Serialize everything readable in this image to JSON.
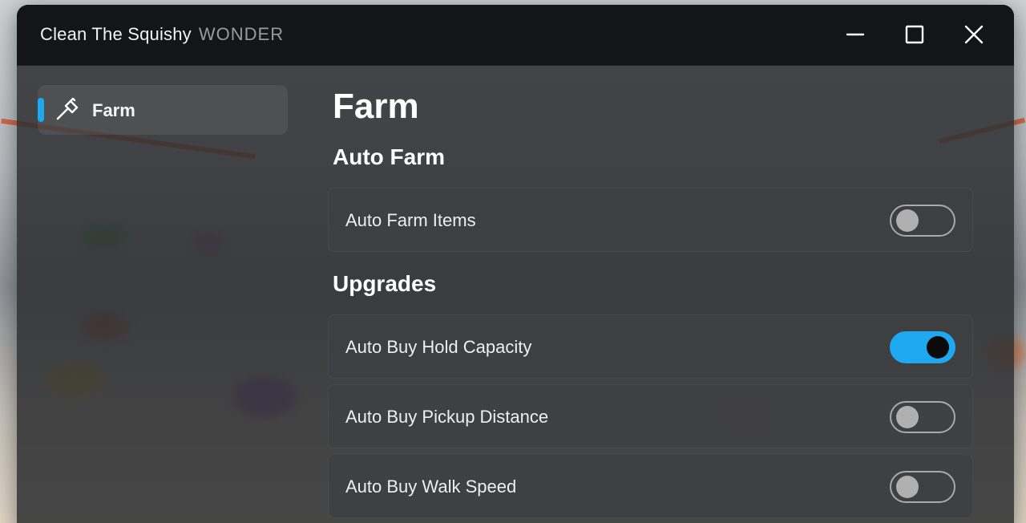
{
  "window": {
    "title": "Clean The Squishy",
    "subtitle": "WONDER"
  },
  "titlebar": {
    "minimize_icon": "minimize-icon",
    "maximize_icon": "maximize-icon",
    "close_icon": "close-icon"
  },
  "sidebar": {
    "items": [
      {
        "label": "Farm",
        "icon": "hammer-icon",
        "selected": true
      }
    ]
  },
  "main": {
    "page_title": "Farm",
    "sections": [
      {
        "title": "Auto Farm",
        "toggles": [
          {
            "label": "Auto Farm Items",
            "enabled": false
          }
        ]
      },
      {
        "title": "Upgrades",
        "toggles": [
          {
            "label": "Auto Buy Hold Capacity",
            "enabled": true
          },
          {
            "label": "Auto Buy Pickup Distance",
            "enabled": false
          },
          {
            "label": "Auto Buy Walk Speed",
            "enabled": false
          }
        ]
      }
    ]
  },
  "colors": {
    "accent": "#1ea8f0",
    "titlebar": "#141517",
    "panel": "#2c2d30",
    "row": "#3e3f42"
  }
}
